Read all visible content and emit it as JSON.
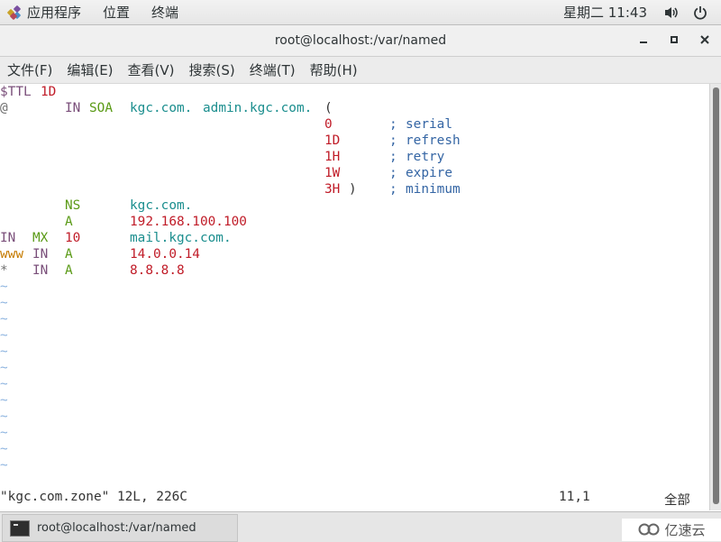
{
  "topbar": {
    "apps_label": "应用程序",
    "places_label": "位置",
    "terminal_label": "终端",
    "clock": "星期二 11:43",
    "volume_icon": "volume-icon",
    "power_icon": "power-icon"
  },
  "window": {
    "title": "root@localhost:/var/named",
    "minimize": "_",
    "maximize": "▫",
    "close": "✕"
  },
  "menubar": {
    "items": [
      "文件(F)",
      "编辑(E)",
      "查看(V)",
      "搜索(S)",
      "终端(T)",
      "帮助(H)"
    ]
  },
  "editor": {
    "lines": [
      [
        {
          "t": "$TTL ",
          "c": "purple",
          "col": 0
        },
        {
          "t": "1D",
          "c": "red",
          "col": 5
        }
      ],
      [
        {
          "t": "@",
          "c": "gray",
          "col": 0
        },
        {
          "t": "IN",
          "c": "purple",
          "col": 8
        },
        {
          "t": "SOA",
          "c": "green",
          "col": 11
        },
        {
          "t": "kgc.com.",
          "c": "teal",
          "col": 16
        },
        {
          "t": "admin.kgc.com.",
          "c": "teal",
          "col": 25
        },
        {
          "t": "(",
          "c": "dark",
          "col": 40
        }
      ],
      [
        {
          "t": "0",
          "c": "red",
          "col": 40
        },
        {
          "t": ";",
          "c": "blue",
          "col": 48
        },
        {
          "t": "serial",
          "c": "blue",
          "col": 50
        }
      ],
      [
        {
          "t": "1D",
          "c": "red",
          "col": 40
        },
        {
          "t": ";",
          "c": "blue",
          "col": 48
        },
        {
          "t": "refresh",
          "c": "blue",
          "col": 50
        }
      ],
      [
        {
          "t": "1H",
          "c": "red",
          "col": 40
        },
        {
          "t": ";",
          "c": "blue",
          "col": 48
        },
        {
          "t": "retry",
          "c": "blue",
          "col": 50
        }
      ],
      [
        {
          "t": "1W",
          "c": "red",
          "col": 40
        },
        {
          "t": ";",
          "c": "blue",
          "col": 48
        },
        {
          "t": "expire",
          "c": "blue",
          "col": 50
        }
      ],
      [
        {
          "t": "3H",
          "c": "red",
          "col": 40
        },
        {
          "t": ")",
          "c": "dark",
          "col": 43
        },
        {
          "t": ";",
          "c": "blue",
          "col": 48
        },
        {
          "t": "minimum",
          "c": "blue",
          "col": 50
        }
      ],
      [
        {
          "t": "NS",
          "c": "green",
          "col": 8
        },
        {
          "t": "kgc.com.",
          "c": "teal",
          "col": 16
        }
      ],
      [
        {
          "t": "A",
          "c": "green",
          "col": 8
        },
        {
          "t": "192.168.100.100",
          "c": "red",
          "col": 16
        }
      ],
      [
        {
          "t": "IN",
          "c": "purple",
          "col": 0
        },
        {
          "t": "MX",
          "c": "green",
          "col": 4
        },
        {
          "t": "10",
          "c": "red",
          "col": 8
        },
        {
          "t": "mail.kgc.com.",
          "c": "teal",
          "col": 16
        }
      ],
      [
        {
          "t": "www",
          "c": "orange",
          "col": 0
        },
        {
          "t": "IN",
          "c": "purple",
          "col": 4
        },
        {
          "t": "A",
          "c": "green",
          "col": 8
        },
        {
          "t": "14.0.0.14",
          "c": "red",
          "col": 16
        }
      ],
      [
        {
          "t": "*",
          "c": "gray",
          "col": 0
        },
        {
          "t": "IN",
          "c": "purple",
          "col": 4
        },
        {
          "t": "A",
          "c": "green",
          "col": 8
        },
        {
          "t": "8.8.8.8",
          "c": "red",
          "col": 16
        }
      ]
    ],
    "empty_line_marker": "~",
    "empty_lines": 12,
    "status_file": "\"kgc.com.zone\" 12L, 226C",
    "status_pos": "11,1",
    "status_scroll": "全部"
  },
  "taskbar": {
    "task_label": "root@localhost:/var/named"
  },
  "watermark": {
    "text": "亿速云"
  }
}
